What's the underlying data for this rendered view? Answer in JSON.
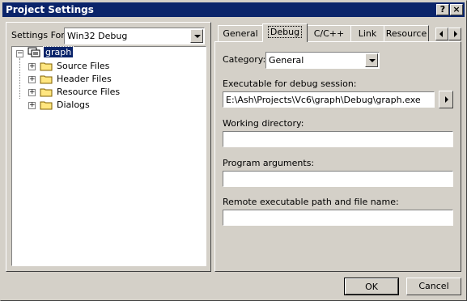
{
  "window": {
    "title": "Project Settings",
    "help_label": "?",
    "close_label": "×"
  },
  "left": {
    "settings_for_label": "Settings For:",
    "settings_for_value": "Win32 Debug",
    "tree": {
      "root": "graph",
      "children": [
        "Source Files",
        "Header Files",
        "Resource Files",
        "Dialogs"
      ]
    }
  },
  "tabs": [
    "General",
    "Debug",
    "C/C++",
    "Link",
    "Resource"
  ],
  "active_tab": "Debug",
  "debug": {
    "category_label": "Category:",
    "category_value": "General",
    "exe_label": "Executable for debug session:",
    "exe_value": "E:\\Ash\\Projects\\Vc6\\graph\\Debug\\graph.exe",
    "workdir_label": "Working directory:",
    "workdir_value": "",
    "args_label": "Program arguments:",
    "args_value": "",
    "remote_label": "Remote executable path and file name:",
    "remote_value": ""
  },
  "buttons": {
    "ok": "OK",
    "cancel": "Cancel"
  }
}
